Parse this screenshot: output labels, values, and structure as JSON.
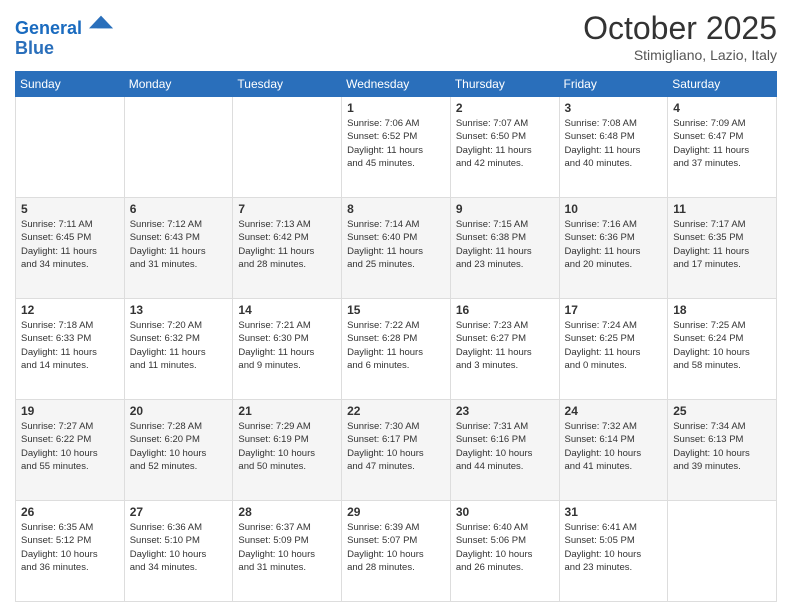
{
  "header": {
    "logo_line1": "General",
    "logo_line2": "Blue",
    "month": "October 2025",
    "location": "Stimigliano, Lazio, Italy"
  },
  "days_of_week": [
    "Sunday",
    "Monday",
    "Tuesday",
    "Wednesday",
    "Thursday",
    "Friday",
    "Saturday"
  ],
  "weeks": [
    [
      {
        "num": "",
        "info": ""
      },
      {
        "num": "",
        "info": ""
      },
      {
        "num": "",
        "info": ""
      },
      {
        "num": "1",
        "info": "Sunrise: 7:06 AM\nSunset: 6:52 PM\nDaylight: 11 hours\nand 45 minutes."
      },
      {
        "num": "2",
        "info": "Sunrise: 7:07 AM\nSunset: 6:50 PM\nDaylight: 11 hours\nand 42 minutes."
      },
      {
        "num": "3",
        "info": "Sunrise: 7:08 AM\nSunset: 6:48 PM\nDaylight: 11 hours\nand 40 minutes."
      },
      {
        "num": "4",
        "info": "Sunrise: 7:09 AM\nSunset: 6:47 PM\nDaylight: 11 hours\nand 37 minutes."
      }
    ],
    [
      {
        "num": "5",
        "info": "Sunrise: 7:11 AM\nSunset: 6:45 PM\nDaylight: 11 hours\nand 34 minutes."
      },
      {
        "num": "6",
        "info": "Sunrise: 7:12 AM\nSunset: 6:43 PM\nDaylight: 11 hours\nand 31 minutes."
      },
      {
        "num": "7",
        "info": "Sunrise: 7:13 AM\nSunset: 6:42 PM\nDaylight: 11 hours\nand 28 minutes."
      },
      {
        "num": "8",
        "info": "Sunrise: 7:14 AM\nSunset: 6:40 PM\nDaylight: 11 hours\nand 25 minutes."
      },
      {
        "num": "9",
        "info": "Sunrise: 7:15 AM\nSunset: 6:38 PM\nDaylight: 11 hours\nand 23 minutes."
      },
      {
        "num": "10",
        "info": "Sunrise: 7:16 AM\nSunset: 6:36 PM\nDaylight: 11 hours\nand 20 minutes."
      },
      {
        "num": "11",
        "info": "Sunrise: 7:17 AM\nSunset: 6:35 PM\nDaylight: 11 hours\nand 17 minutes."
      }
    ],
    [
      {
        "num": "12",
        "info": "Sunrise: 7:18 AM\nSunset: 6:33 PM\nDaylight: 11 hours\nand 14 minutes."
      },
      {
        "num": "13",
        "info": "Sunrise: 7:20 AM\nSunset: 6:32 PM\nDaylight: 11 hours\nand 11 minutes."
      },
      {
        "num": "14",
        "info": "Sunrise: 7:21 AM\nSunset: 6:30 PM\nDaylight: 11 hours\nand 9 minutes."
      },
      {
        "num": "15",
        "info": "Sunrise: 7:22 AM\nSunset: 6:28 PM\nDaylight: 11 hours\nand 6 minutes."
      },
      {
        "num": "16",
        "info": "Sunrise: 7:23 AM\nSunset: 6:27 PM\nDaylight: 11 hours\nand 3 minutes."
      },
      {
        "num": "17",
        "info": "Sunrise: 7:24 AM\nSunset: 6:25 PM\nDaylight: 11 hours\nand 0 minutes."
      },
      {
        "num": "18",
        "info": "Sunrise: 7:25 AM\nSunset: 6:24 PM\nDaylight: 10 hours\nand 58 minutes."
      }
    ],
    [
      {
        "num": "19",
        "info": "Sunrise: 7:27 AM\nSunset: 6:22 PM\nDaylight: 10 hours\nand 55 minutes."
      },
      {
        "num": "20",
        "info": "Sunrise: 7:28 AM\nSunset: 6:20 PM\nDaylight: 10 hours\nand 52 minutes."
      },
      {
        "num": "21",
        "info": "Sunrise: 7:29 AM\nSunset: 6:19 PM\nDaylight: 10 hours\nand 50 minutes."
      },
      {
        "num": "22",
        "info": "Sunrise: 7:30 AM\nSunset: 6:17 PM\nDaylight: 10 hours\nand 47 minutes."
      },
      {
        "num": "23",
        "info": "Sunrise: 7:31 AM\nSunset: 6:16 PM\nDaylight: 10 hours\nand 44 minutes."
      },
      {
        "num": "24",
        "info": "Sunrise: 7:32 AM\nSunset: 6:14 PM\nDaylight: 10 hours\nand 41 minutes."
      },
      {
        "num": "25",
        "info": "Sunrise: 7:34 AM\nSunset: 6:13 PM\nDaylight: 10 hours\nand 39 minutes."
      }
    ],
    [
      {
        "num": "26",
        "info": "Sunrise: 6:35 AM\nSunset: 5:12 PM\nDaylight: 10 hours\nand 36 minutes."
      },
      {
        "num": "27",
        "info": "Sunrise: 6:36 AM\nSunset: 5:10 PM\nDaylight: 10 hours\nand 34 minutes."
      },
      {
        "num": "28",
        "info": "Sunrise: 6:37 AM\nSunset: 5:09 PM\nDaylight: 10 hours\nand 31 minutes."
      },
      {
        "num": "29",
        "info": "Sunrise: 6:39 AM\nSunset: 5:07 PM\nDaylight: 10 hours\nand 28 minutes."
      },
      {
        "num": "30",
        "info": "Sunrise: 6:40 AM\nSunset: 5:06 PM\nDaylight: 10 hours\nand 26 minutes."
      },
      {
        "num": "31",
        "info": "Sunrise: 6:41 AM\nSunset: 5:05 PM\nDaylight: 10 hours\nand 23 minutes."
      },
      {
        "num": "",
        "info": ""
      }
    ]
  ]
}
